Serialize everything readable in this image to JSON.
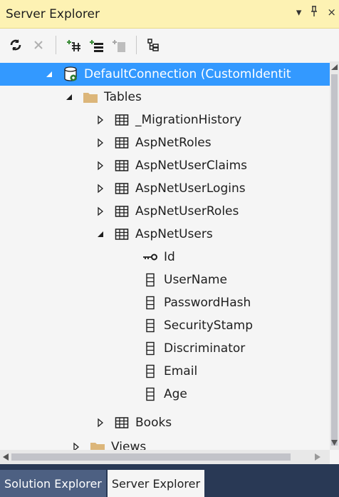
{
  "panel": {
    "title": "Server Explorer",
    "pin_glyph": "▾",
    "autohide_glyph": "⊥",
    "close_glyph": "×"
  },
  "toolbar": {
    "icons": [
      "refresh-icon",
      "stop-icon",
      "connect-to-database-icon",
      "connect-to-server-icon",
      "connect-to-sharepoint-icon",
      "filter-icon"
    ]
  },
  "tree": {
    "connection": "DefaultConnection (CustomIdentit",
    "tables_folder": "Tables",
    "tables": [
      {
        "name": "_MigrationHistory",
        "expanded": false
      },
      {
        "name": "AspNetRoles",
        "expanded": false
      },
      {
        "name": "AspNetUserClaims",
        "expanded": false
      },
      {
        "name": "AspNetUserLogins",
        "expanded": false
      },
      {
        "name": "AspNetUserRoles",
        "expanded": false
      },
      {
        "name": "AspNetUsers",
        "expanded": true
      }
    ],
    "columns": [
      "Id",
      "UserName",
      "PasswordHash",
      "SecurityStamp",
      "Discriminator",
      "Email",
      "Age"
    ],
    "books": "Books",
    "views_folder": "Views"
  },
  "tabs": [
    {
      "label": "Solution Explorer",
      "active": false
    },
    {
      "label": "Server Explorer",
      "active": true
    }
  ],
  "colors": {
    "title_bg": "#fdf2b3",
    "selection": "#3399ff",
    "tab_strip": "#293955"
  }
}
